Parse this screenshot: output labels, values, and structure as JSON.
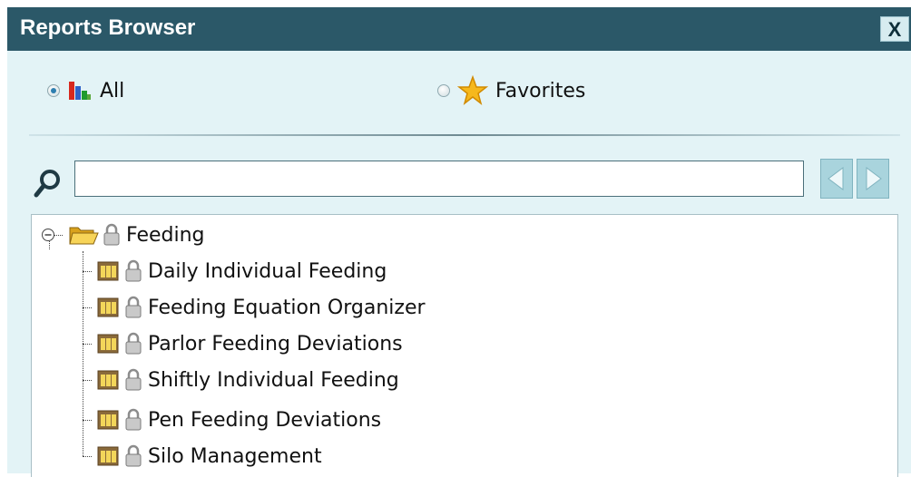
{
  "window": {
    "title": "Reports Browser",
    "close_label": "X"
  },
  "filter": {
    "all": {
      "label": "All",
      "selected": true,
      "icon": "bar-chart-icon"
    },
    "favorites": {
      "label": "Favorites",
      "selected": false,
      "icon": "star-icon"
    }
  },
  "search": {
    "value": "",
    "placeholder": "",
    "prev_icon": "arrow-left-icon",
    "next_icon": "arrow-right-icon"
  },
  "tree": {
    "folder": {
      "label": "Feeding",
      "expanded": true,
      "icon": "folder-open-icon",
      "lock_icon": "lock-icon"
    },
    "items": [
      {
        "label": "Daily Individual Feeding",
        "icon": "report-grid-icon"
      },
      {
        "label": "Feeding Equation Organizer",
        "icon": "report-grid-icon"
      },
      {
        "label": "Parlor Feeding Deviations",
        "icon": "report-grid-icon"
      },
      {
        "label": "Shiftly Individual Feeding",
        "icon": "report-grid-icon"
      },
      {
        "label": "Pen Feeding Deviations",
        "icon": "report-grid-icon"
      },
      {
        "label": "Silo Management",
        "icon": "report-grid-icon"
      }
    ]
  },
  "colors": {
    "titlebar": "#2b5868",
    "panel": "#e3f3f6",
    "nav_button": "#a9d4dd"
  }
}
